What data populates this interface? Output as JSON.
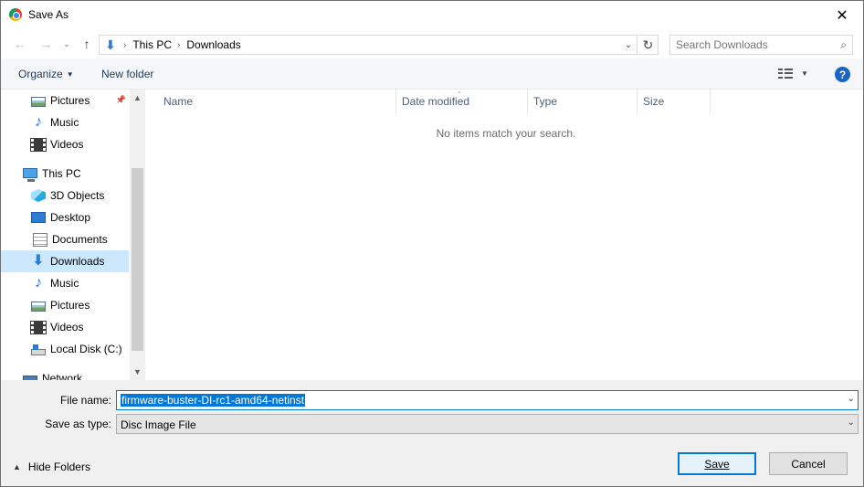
{
  "window": {
    "title": "Save As",
    "close_glyph": "✕"
  },
  "address": {
    "crumbs": [
      "This PC",
      "Downloads"
    ]
  },
  "search": {
    "placeholder": "Search Downloads"
  },
  "toolbar": {
    "organize_label": "Organize",
    "new_folder_label": "New folder",
    "help_glyph": "?"
  },
  "sidebar": {
    "items": [
      {
        "label": "Pictures",
        "icon": "pictures-icon",
        "pinned": true
      },
      {
        "label": "Music",
        "icon": "music-icon"
      },
      {
        "label": "Videos",
        "icon": "videos-icon"
      },
      {
        "label": "This PC",
        "icon": "this-pc-icon"
      },
      {
        "label": "3D Objects",
        "icon": "3d-objects-icon"
      },
      {
        "label": "Desktop",
        "icon": "desktop-icon"
      },
      {
        "label": "Documents",
        "icon": "documents-icon"
      },
      {
        "label": "Downloads",
        "icon": "downloads-icon",
        "selected": true
      },
      {
        "label": "Music",
        "icon": "music-icon"
      },
      {
        "label": "Pictures",
        "icon": "pictures-icon"
      },
      {
        "label": "Videos",
        "icon": "videos-icon"
      },
      {
        "label": "Local Disk (C:)",
        "icon": "local-disk-icon"
      },
      {
        "label": "Network",
        "icon": "network-icon"
      }
    ]
  },
  "content": {
    "columns": [
      "Name",
      "Date modified",
      "Type",
      "Size"
    ],
    "empty_message": "No items match your search."
  },
  "form": {
    "file_name_label": "File name:",
    "file_name_value": "firmware-buster-DI-rc1-amd64-netinst",
    "save_as_type_label": "Save as type:",
    "save_as_type_value": "Disc Image File"
  },
  "footer": {
    "hide_folders_label": "Hide Folders",
    "save_label": "Save",
    "cancel_label": "Cancel"
  },
  "colors": {
    "accent": "#0078d7",
    "selection": "#cce8ff",
    "link_text": "#1e395b"
  }
}
